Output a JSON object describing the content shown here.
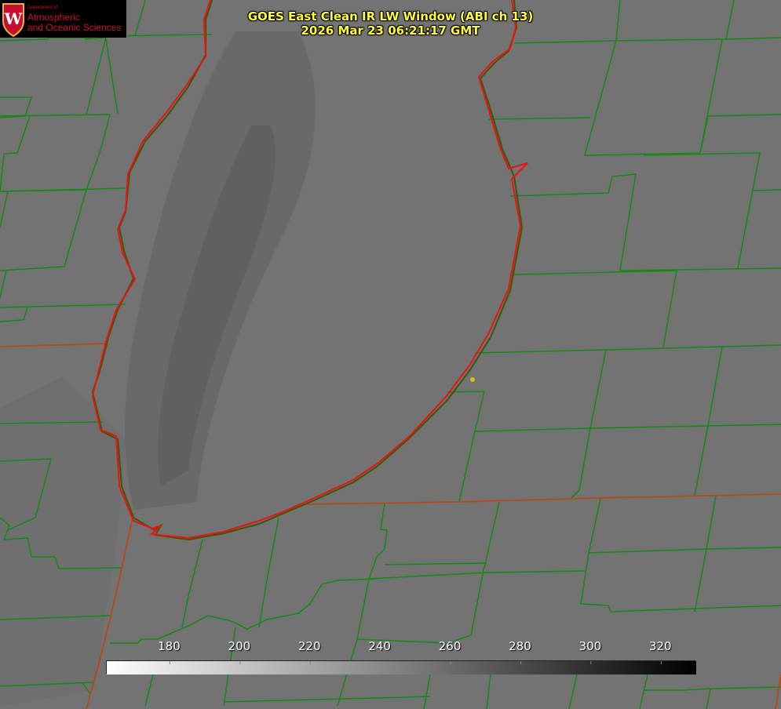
{
  "header": {
    "org_small": "Department of",
    "org_line1": "Atmospheric",
    "org_line2": "and Oceanic Sciences",
    "logo_letter": "W",
    "title_line1": "GOES East Clean IR LW Window (ABI ch 13)",
    "title_line2": "2026 Mar 23 06:21:17 GMT"
  },
  "colorbar": {
    "ticks": [
      "180",
      "200",
      "220",
      "240",
      "260",
      "280",
      "300",
      "320"
    ],
    "colormap": "white-to-black",
    "min_value": 162,
    "max_value": 330
  },
  "colors": {
    "background_gray": "#737373",
    "county_lines": "#128a12",
    "state_lines": "#b34a1a",
    "lake_outline": "#ee1111",
    "title_text": "#ffff33",
    "marker": "#d4c21a"
  }
}
